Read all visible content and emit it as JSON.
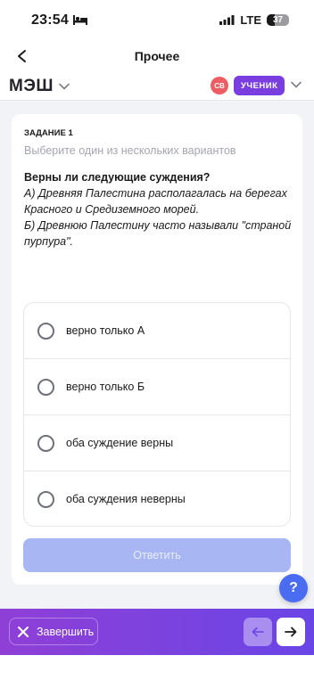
{
  "status_bar": {
    "time": "23:54",
    "network": "LTE",
    "battery": "37",
    "battery_level": 0.37
  },
  "nav": {
    "title": "Прочее"
  },
  "header": {
    "logo": "МЭШ",
    "avatar_initials": "СВ",
    "role": "УЧЕНИК"
  },
  "task": {
    "label": "ЗАДАНИЕ 1",
    "instruction": "Выберите один из нескольких вариантов",
    "question_title": "Верны ли следующие суждения?",
    "question_lines": [
      "А) Древняя Палестина располагалась на берегах Красного и Средиземного морей.",
      "Б) Древнюю Палестину часто называли \"страной пурпура\"."
    ],
    "options": [
      "верно только А",
      "верно только Б",
      "оба суждение верны",
      "оба суждения неверны"
    ],
    "submit_label": "Ответить"
  },
  "help": {
    "label": "?"
  },
  "bottom_bar": {
    "finish_label": "Завершить"
  },
  "colors": {
    "accent": "#7a3ee0",
    "submit_disabled": "#a8b6f4",
    "help": "#4a6cf0"
  }
}
